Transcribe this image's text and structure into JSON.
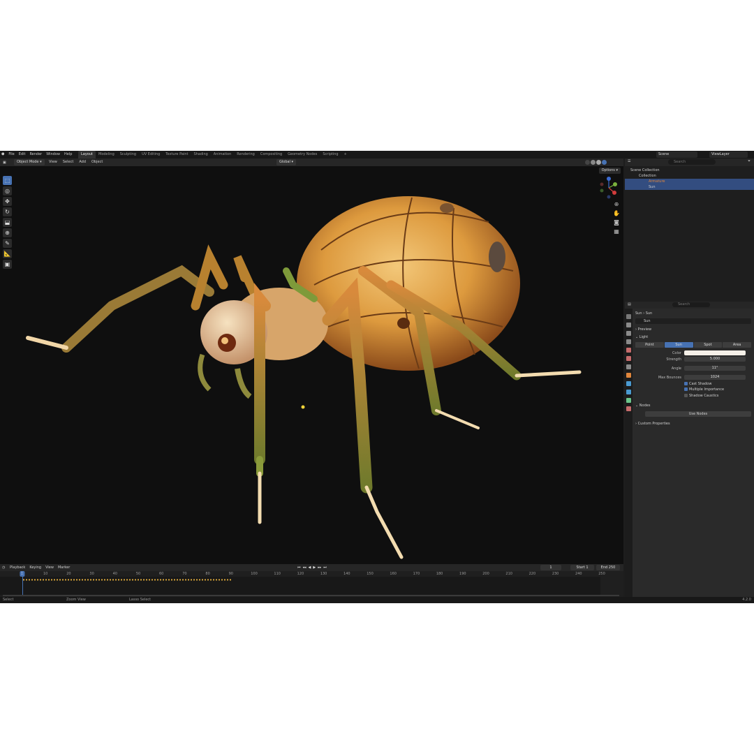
{
  "topbar": {
    "menus": [
      "File",
      "Edit",
      "Render",
      "Window",
      "Help"
    ],
    "workspaces": [
      "Layout",
      "Modeling",
      "Sculpting",
      "UV Editing",
      "Texture Paint",
      "Shading",
      "Animation",
      "Rendering",
      "Compositing",
      "Geometry Nodes",
      "Scripting"
    ],
    "active_workspace": "Layout",
    "scene": "Scene",
    "view_layer": "ViewLayer"
  },
  "viewport_header": {
    "mode": "Object Mode",
    "menus": [
      "View",
      "Select",
      "Add",
      "Object"
    ],
    "orientation": "Global",
    "options": "Options"
  },
  "timeline": {
    "menus": [
      "Playback",
      "Keying",
      "View",
      "Marker"
    ],
    "current_frame": "1",
    "start_label": "Start",
    "start": "1",
    "end_label": "End",
    "end": "250",
    "ruler": [
      "1",
      "10",
      "20",
      "30",
      "40",
      "50",
      "60",
      "70",
      "80",
      "90",
      "100",
      "110",
      "120",
      "130",
      "140",
      "150",
      "160",
      "170",
      "180",
      "190",
      "200",
      "210",
      "220",
      "230",
      "240",
      "250"
    ]
  },
  "statusbar": {
    "left": "Select",
    "middle": "Zoom View",
    "right": "Lasso Select",
    "version": "4.2.0"
  },
  "outliner": {
    "search_placeholder": "Search",
    "rows": [
      "Scene Collection",
      "Collection",
      "Armature",
      "Sun"
    ]
  },
  "properties": {
    "search_placeholder": "Search",
    "breadcrumb_object": "Sun",
    "breadcrumb_data": "Sun",
    "datablock": "Sun",
    "panels": {
      "preview": "Preview",
      "light": "Light",
      "nodes": "Nodes",
      "custom": "Custom Properties"
    },
    "light_types": [
      "Point",
      "Sun",
      "Spot",
      "Area"
    ],
    "active_light_type": "Sun",
    "fields": {
      "color_label": "Color",
      "strength_label": "Strength",
      "strength": "5.000",
      "angle_label": "Angle",
      "angle": "11°",
      "bounces_label": "Max Bounces",
      "bounces": "1024"
    },
    "checks": [
      "Cast Shadow",
      "Multiple Importance",
      "Shadow Caustics"
    ],
    "use_nodes": "Use Nodes"
  },
  "colors": {
    "accent": "#4772b3",
    "armature": "#e0863c",
    "keyframes": "#e8b13c"
  }
}
